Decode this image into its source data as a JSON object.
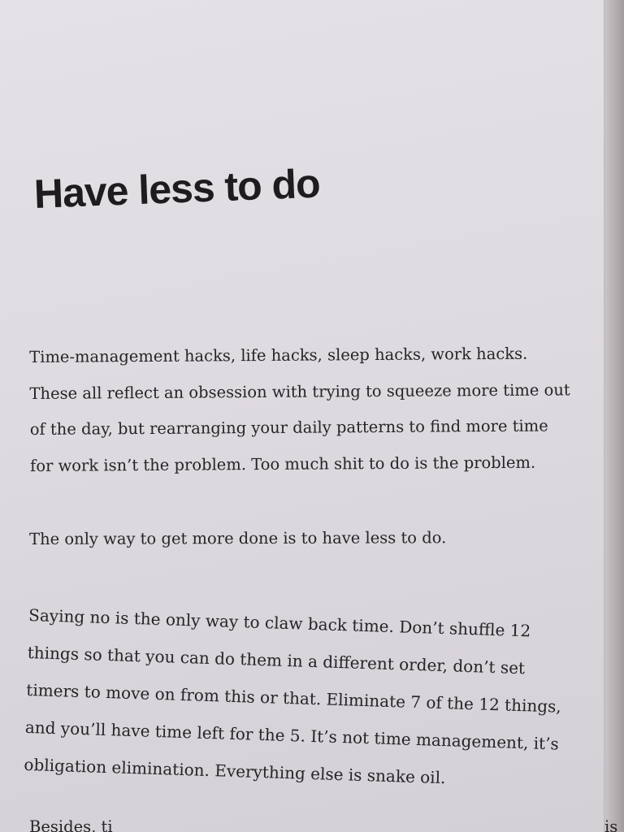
{
  "heading": "Have less to do",
  "paragraphs": [
    {
      "lines": [
        "Time-management hacks, life hacks, sleep hacks, work hacks.",
        "These all reflect an obsession with trying to squeeze more time out",
        "of the day, but rearranging your daily patterns to find more time",
        "for work isn’t the problem. Too much shit to do is the problem."
      ]
    },
    {
      "lines": [
        "The only way to get more done is to have less to do."
      ]
    },
    {
      "lines": [
        "Saying no is the only way to claw back time. Don’t shuffle 12",
        "things so that you can do them in a different order, don’t set",
        "timers to move on from this or that. Eliminate 7 of the 12 things,",
        "and you’ll have time left for the 5. It’s not time management, it’s",
        "obligation elimination. Everything else is snake oil."
      ]
    }
  ],
  "partial_line": {
    "left": "Besides, ti",
    "right": "is"
  }
}
